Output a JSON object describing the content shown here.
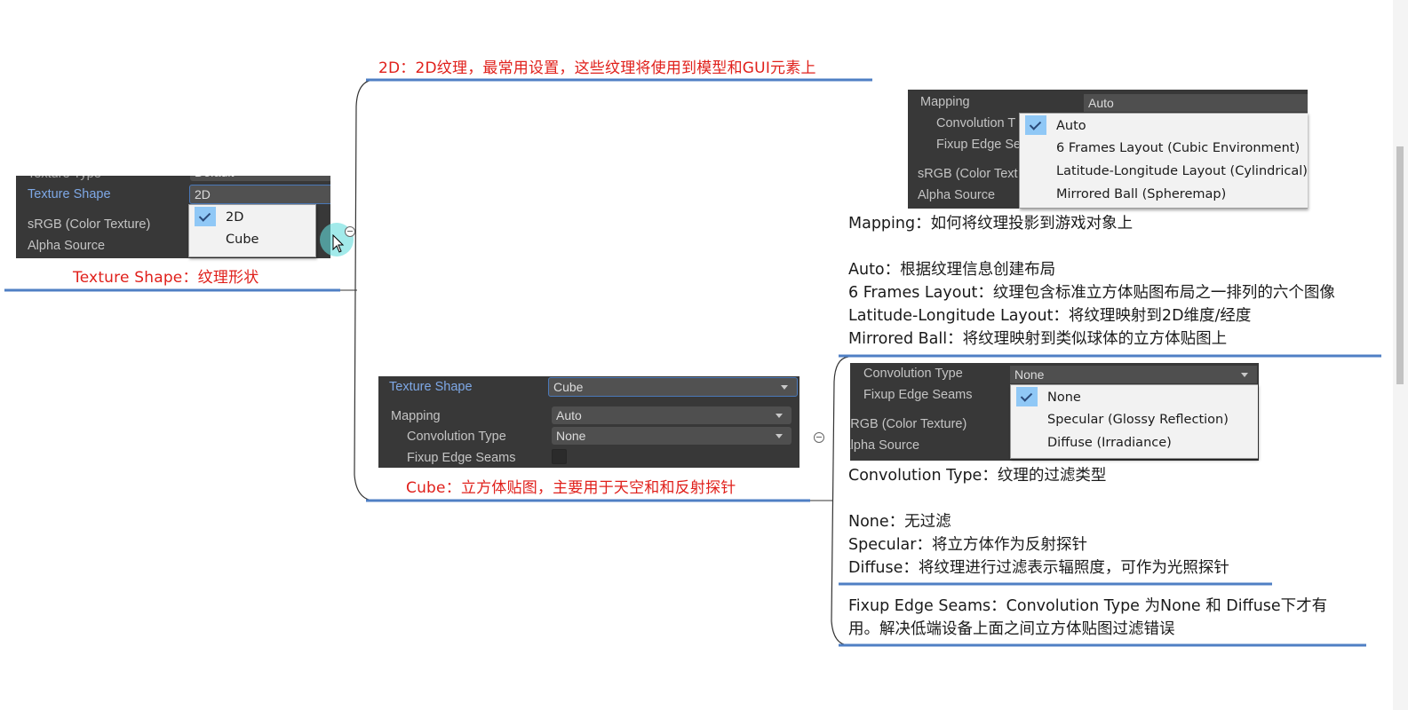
{
  "root": {
    "label": "Texture Shape：纹理形状",
    "inspector": {
      "cut_label": "Texture Type",
      "cut_value": "Default",
      "rows": [
        {
          "label": "Texture Shape",
          "value": "2D"
        },
        {
          "label": "sRGB (Color Texture)"
        },
        {
          "label": "Alpha Source"
        }
      ],
      "dropdown": {
        "options": [
          "2D",
          "Cube"
        ],
        "selected": "2D"
      }
    }
  },
  "branch_2d": {
    "label": "2D：2D纹理，最常用设置，这些纹理将使用到模型和GUI元素上"
  },
  "branch_cube": {
    "label": "Cube：立方体贴图，主要用于天空和和反射探针",
    "inspector": {
      "rows": [
        {
          "label": "Texture Shape",
          "value": "Cube"
        },
        {
          "label": "Mapping",
          "value": "Auto"
        },
        {
          "label": "Convolution Type",
          "value": "None"
        },
        {
          "label": "Fixup Edge Seams",
          "checked": false
        }
      ]
    }
  },
  "mapping_node": {
    "inspector": {
      "rows": [
        {
          "label": "Mapping",
          "value": "Auto"
        },
        {
          "label": "Convolution T"
        },
        {
          "label": "Fixup Edge Se"
        },
        {
          "label": "sRGB (Color Text"
        },
        {
          "label": "Alpha Source"
        }
      ],
      "dropdown": {
        "options": [
          "Auto",
          "6 Frames Layout (Cubic Environment)",
          "Latitude-Longitude Layout (Cylindrical)",
          "Mirrored Ball (Spheremap)"
        ],
        "selected": "Auto"
      }
    },
    "title": "Mapping：如何将纹理投影到游戏对象上",
    "lines": [
      "Auto：根据纹理信息创建布局",
      "6 Frames Layout：纹理包含标准立方体贴图布局之一排列的六个图像",
      "Latitude-Longitude Layout：将纹理映射到2D维度/经度",
      "Mirrored Ball：将纹理映射到类似球体的立方体贴图上"
    ]
  },
  "convolution_node": {
    "inspector": {
      "rows": [
        {
          "label": "Convolution Type",
          "value": "None"
        },
        {
          "label": "Fixup Edge Seams"
        },
        {
          "label": "sRGB (Color Texture)"
        },
        {
          "label": "Alpha Source"
        }
      ],
      "dropdown": {
        "options": [
          "None",
          "Specular (Glossy Reflection)",
          "Diffuse (Irradiance)"
        ],
        "selected": "None"
      }
    },
    "title": "Convolution Type：纹理的过滤类型",
    "lines": [
      "None：无过滤",
      "Specular：将立方体作为反射探针",
      "Diffuse：将纹理进行过滤表示辐照度，可作为光照探针"
    ]
  },
  "fixup_node": {
    "line1": "Fixup Edge Seams：Convolution Type 为None 和 Diffuse下才有",
    "line2": "用。解决低端设备上面之间立方体贴图过滤错误"
  },
  "colors": {
    "branch_line": "#4f7fc4",
    "red_label": "#e0201b",
    "panel_bg": "#383838",
    "selection": "#90c8f6"
  }
}
